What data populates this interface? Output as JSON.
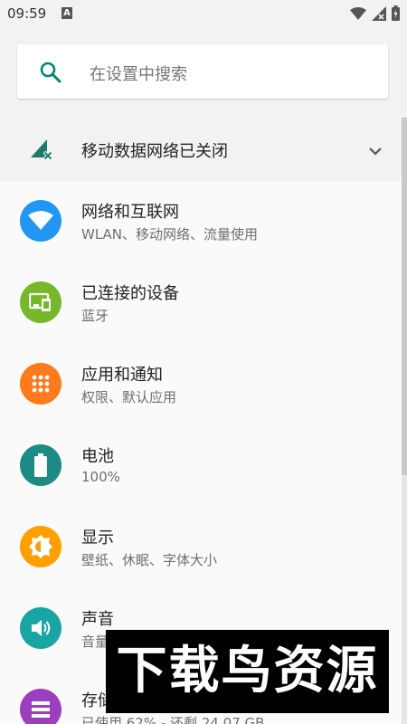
{
  "status_bar": {
    "time": "09:59",
    "notification_letter": "A"
  },
  "search": {
    "placeholder": "在设置中搜索"
  },
  "mobile_data": {
    "label": "移动数据网络已关闭"
  },
  "settings": [
    {
      "name": "network",
      "title": "网络和互联网",
      "subtitle": "WLAN、移动网络、流量使用",
      "icon": "wifi-icon",
      "color": "#2196f3"
    },
    {
      "name": "connected-devices",
      "title": "已连接的设备",
      "subtitle": "蓝牙",
      "icon": "devices-icon",
      "color": "#76b82a"
    },
    {
      "name": "apps",
      "title": "应用和通知",
      "subtitle": "权限、默认应用",
      "icon": "apps-grid-icon",
      "color": "#ff7a1a"
    },
    {
      "name": "battery",
      "title": "电池",
      "subtitle": "100%",
      "icon": "battery-icon",
      "color": "#1e8a84"
    },
    {
      "name": "display",
      "title": "显示",
      "subtitle": "壁纸、休眠、字体大小",
      "icon": "brightness-icon",
      "color": "#ffa000"
    },
    {
      "name": "sound",
      "title": "声音",
      "subtitle": "音量",
      "icon": "volume-icon",
      "color": "#1aa5a5"
    },
    {
      "name": "storage",
      "title": "存储",
      "subtitle": "已使用 62% - 还剩 24.07 GB",
      "icon": "storage-icon",
      "color": "#9b3fbf"
    }
  ],
  "watermark": {
    "text": "下载鸟资源"
  }
}
